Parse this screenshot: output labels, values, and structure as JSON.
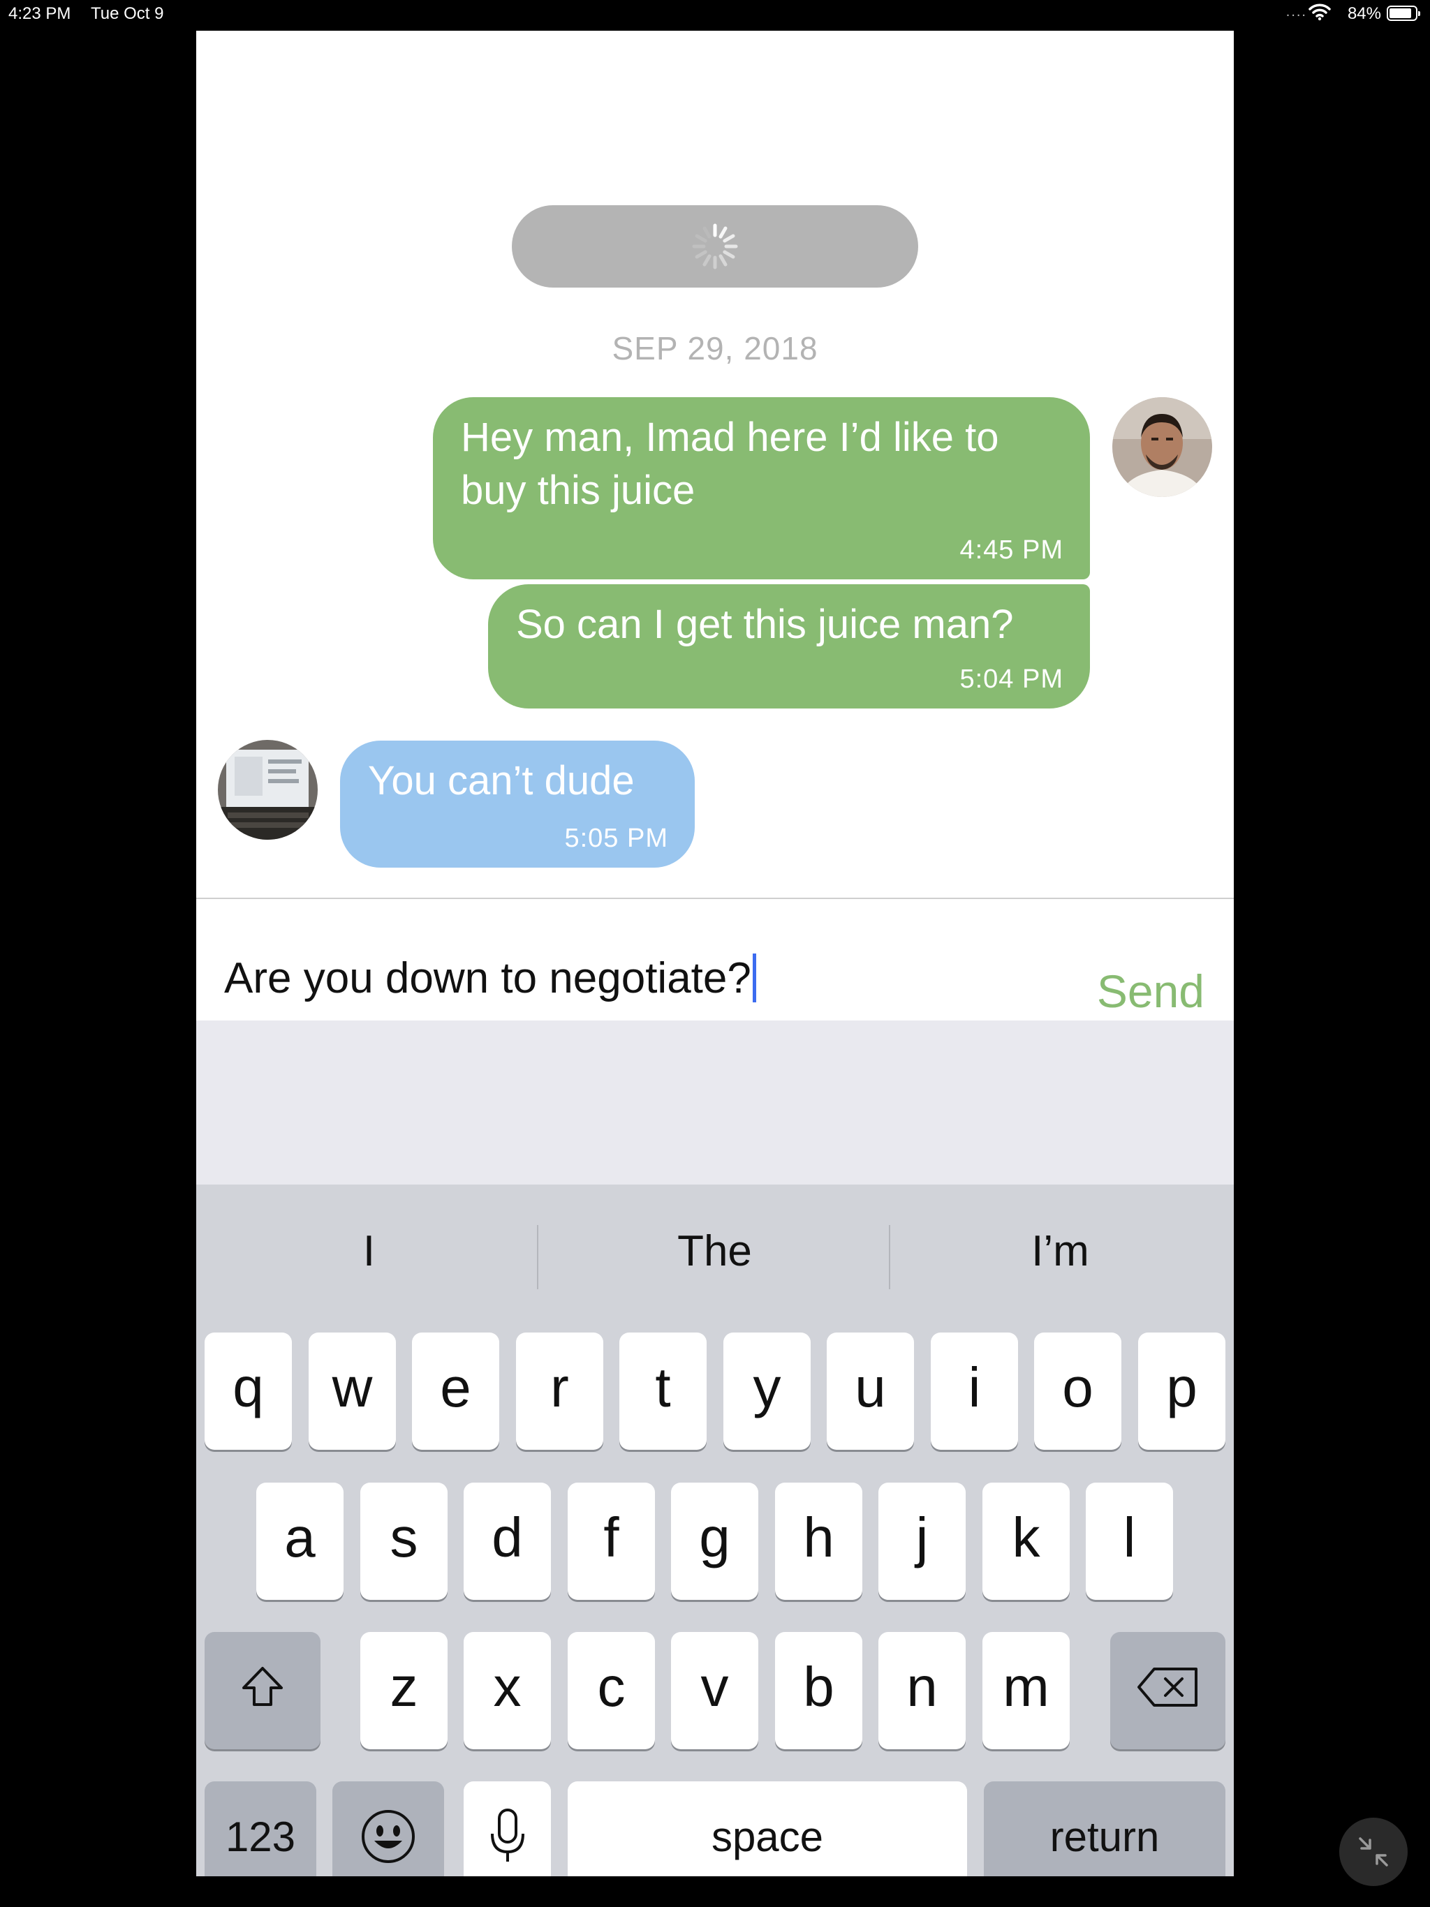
{
  "status_bar": {
    "time": "4:23 PM",
    "date": "Tue Oct 9",
    "signal": "....",
    "battery": "84%"
  },
  "chat": {
    "date_header": "SEP 29, 2018",
    "messages": [
      {
        "direction": "outgoing",
        "text": "Hey man, Imad here I’d like to buy this juice",
        "time": "4:45 PM"
      },
      {
        "direction": "outgoing",
        "text": "So can I get this juice man?",
        "time": "5:04 PM"
      },
      {
        "direction": "incoming",
        "text": "You can’t dude",
        "time": "5:05 PM"
      }
    ]
  },
  "composer": {
    "text": "Are you down to negotiate?",
    "send_label": "Send"
  },
  "keyboard": {
    "suggestions": [
      "I",
      "The",
      "I’m"
    ],
    "row1": [
      "q",
      "w",
      "e",
      "r",
      "t",
      "y",
      "u",
      "i",
      "o",
      "p"
    ],
    "row2": [
      "a",
      "s",
      "d",
      "f",
      "g",
      "h",
      "j",
      "k",
      "l"
    ],
    "row3": [
      "z",
      "x",
      "c",
      "v",
      "b",
      "n",
      "m"
    ],
    "numbers_label": "123",
    "space_label": "space",
    "return_label": "return"
  },
  "colors": {
    "outgoing_bubble": "#88bb72",
    "incoming_bubble": "#9ac6ef",
    "send": "#88bb72",
    "caret": "#3c6cf0"
  },
  "icons": [
    "wifi-icon",
    "battery-icon",
    "spinner-icon",
    "shift-icon",
    "delete-icon",
    "emoji-icon",
    "microphone-icon",
    "minimize-icon"
  ]
}
